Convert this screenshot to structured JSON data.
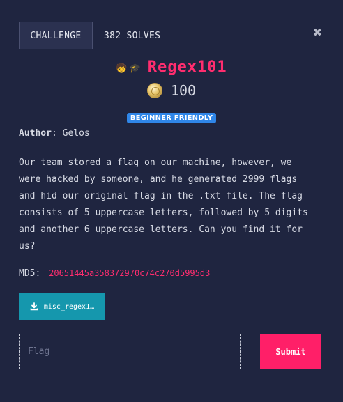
{
  "tabs": [
    {
      "label": "CHALLENGE",
      "active": true
    },
    {
      "label": "382 SOLVES",
      "active": false
    }
  ],
  "close": {
    "symbol": "✖"
  },
  "challenge": {
    "emoji": [
      "🧒",
      "🎓"
    ],
    "title": "Regex101",
    "points": "100",
    "badge": "BEGINNER FRIENDLY",
    "author_key": "Author",
    "author_value": "Gelos",
    "description": "Our team stored a flag on our machine, however, we\nwere hacked by someone, and he generated 2999 flags\nand hid our original flag in the .txt file. The flag\nconsists of 5 uppercase letters, followed by 5 digits\nand another 6 uppercase letters. Can you find it for\nus?",
    "md5_label": "MD5:",
    "md5_hash": "20651445a358372970c74c270d5995d3",
    "file_label": "misc_regex1…"
  },
  "form": {
    "flag_placeholder": "Flag",
    "flag_value": "",
    "submit_label": "Submit"
  },
  "colors": {
    "background": "#1f2540",
    "accent": "#ff2d6f",
    "badge": "#2f86e8",
    "file_button": "#1597ad",
    "submit": "#ff1f68"
  },
  "icons": {
    "close": "close-icon",
    "coin": "coin-icon",
    "download": "download-icon"
  }
}
